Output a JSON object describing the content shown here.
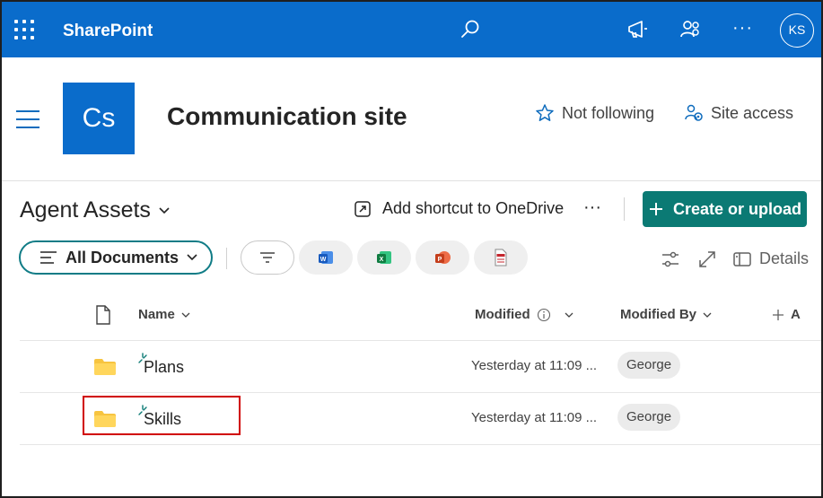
{
  "suite_bar": {
    "brand": "SharePoint",
    "avatar_initials": "KS",
    "more": "···",
    "icons": [
      "app-launcher-icon",
      "search-icon",
      "megaphone-icon",
      "people-settings-icon"
    ]
  },
  "site": {
    "logo_text": "Cs",
    "title": "Communication site",
    "follow_label": "Not following",
    "site_access_label": "Site access"
  },
  "library": {
    "title": "Agent Assets",
    "shortcut_label": "Add shortcut to OneDrive",
    "more": "···",
    "create_label": "Create or upload",
    "view_label": "All Documents",
    "details_label": "Details",
    "filter_pills": [
      "filter-icon",
      "word-icon",
      "excel-icon",
      "powerpoint-icon",
      "pdf-icon"
    ]
  },
  "table": {
    "columns": {
      "name": "Name",
      "modified": "Modified",
      "modified_by": "Modified By",
      "add_column": "A"
    },
    "rows": [
      {
        "name": "Plans",
        "modified": "Yesterday at 11:09 ...",
        "modified_by": "George"
      },
      {
        "name": "Skills",
        "modified": "Yesterday at 11:09 ...",
        "modified_by": "George"
      }
    ]
  },
  "colors": {
    "suite_bar": "#0a6ccb",
    "create_button": "#0b7a74",
    "view_outline": "#107c86",
    "highlight_box": "#d00000",
    "folder": "#f7c440"
  }
}
